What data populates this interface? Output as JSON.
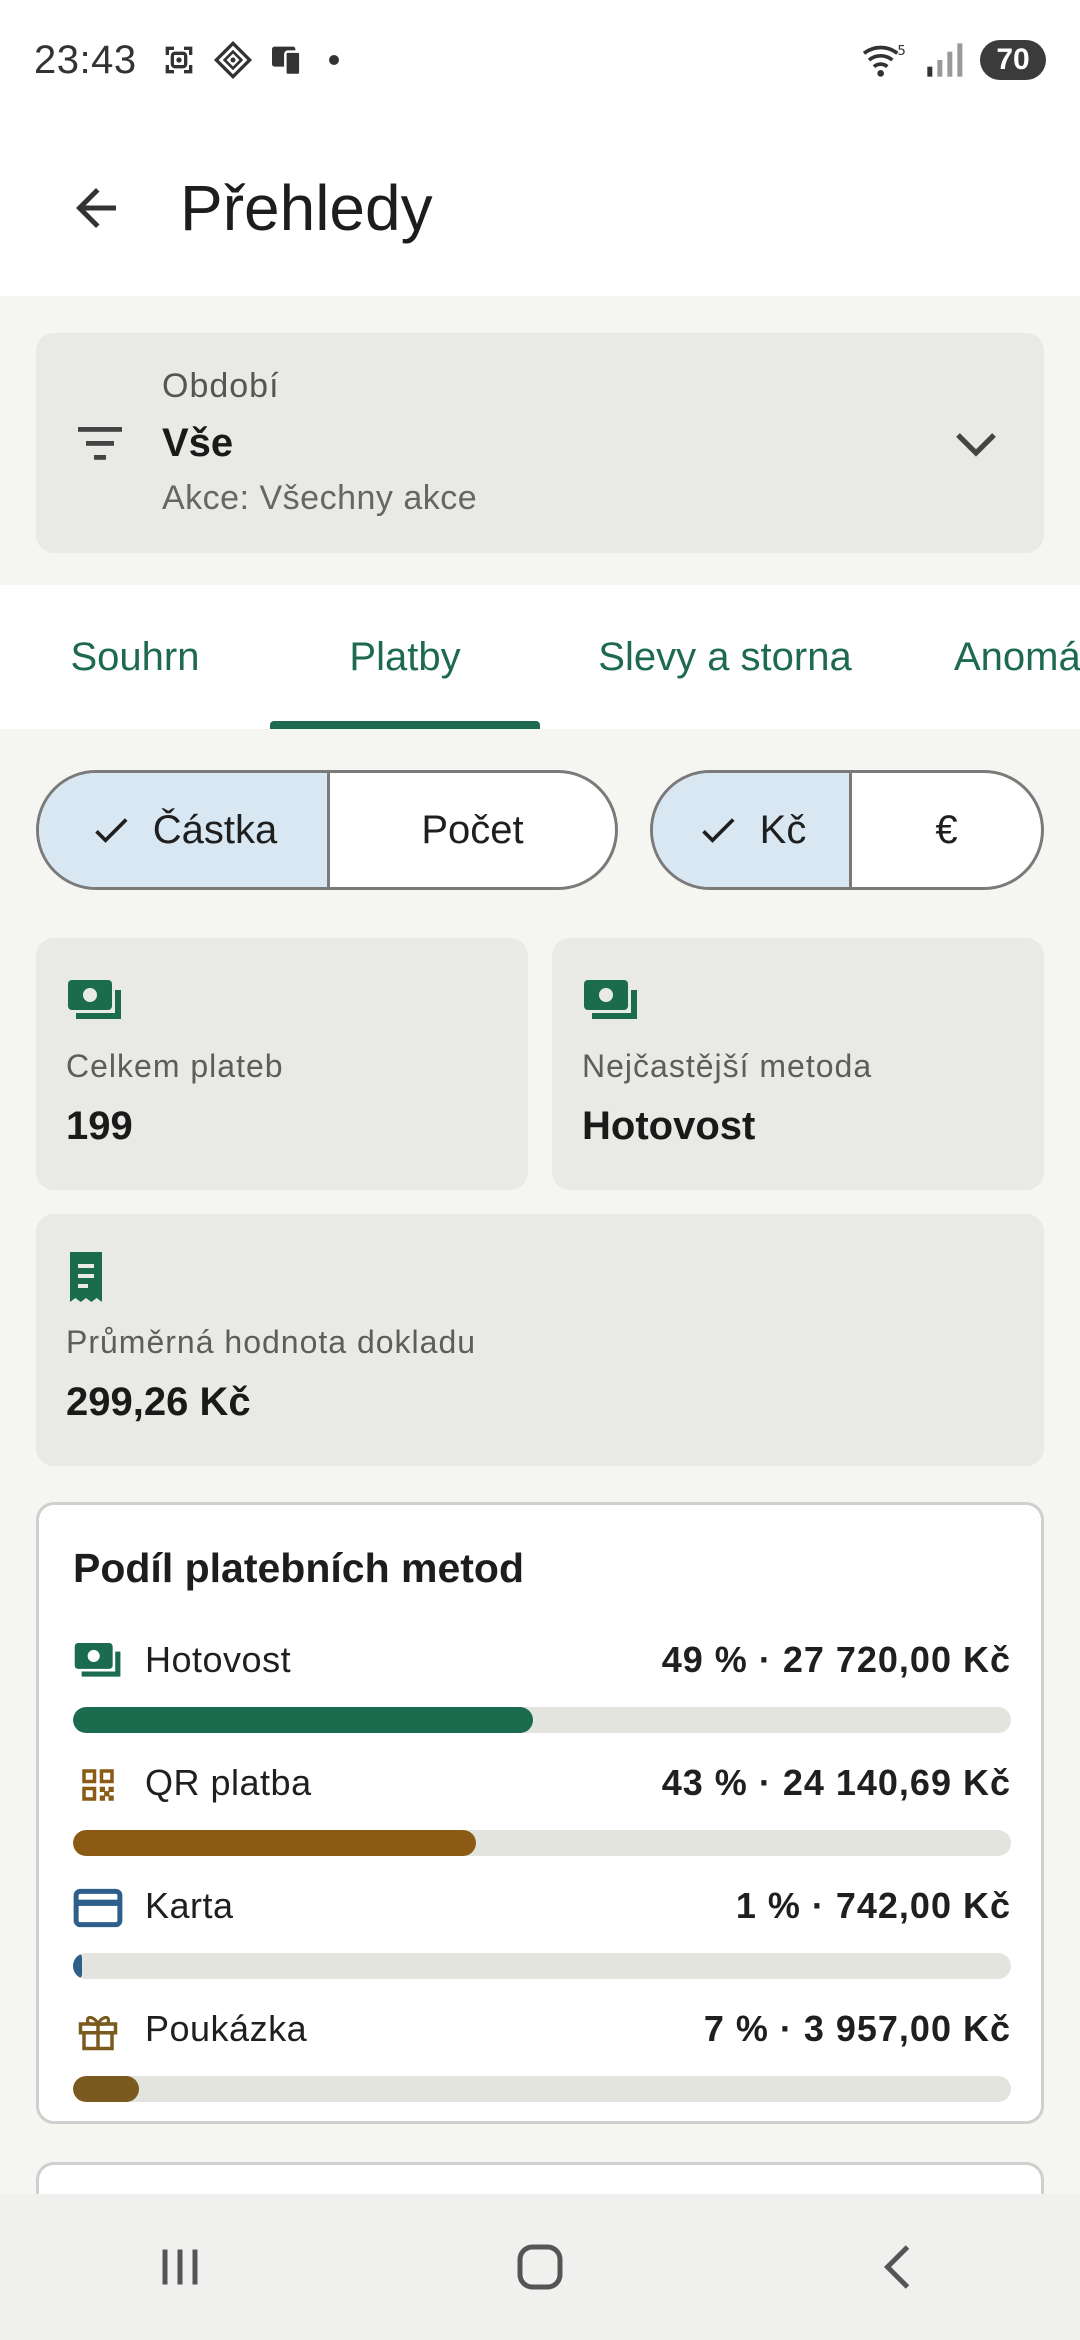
{
  "status_bar": {
    "time": "23:43",
    "battery": "70",
    "icons": [
      "screenshot-icon",
      "smart-view-icon",
      "device-icon",
      "notification-dot",
      "wifi-icon",
      "signal-icon",
      "battery-icon"
    ]
  },
  "app_bar": {
    "title": "Přehledy",
    "back_icon": "arrow-back-icon"
  },
  "filter": {
    "label": "Období",
    "value": "Vše",
    "subtitle": "Akce: Všechny akce",
    "icon": "filter-list-icon",
    "chevron": "chevron-down-icon"
  },
  "tabs": {
    "items": [
      {
        "label": "Souhrn",
        "active": false
      },
      {
        "label": "Platby",
        "active": true
      },
      {
        "label": "Slevy a storna",
        "active": false
      },
      {
        "label": "Anomá",
        "active": false
      }
    ]
  },
  "toggles": {
    "metric": [
      {
        "label": "Částka",
        "selected": true
      },
      {
        "label": "Počet",
        "selected": false
      }
    ],
    "currency": [
      {
        "label": "Kč",
        "selected": true
      },
      {
        "label": "€",
        "selected": false
      }
    ]
  },
  "stats": {
    "total_payments": {
      "label": "Celkem plateb",
      "value": "199",
      "icon": "payments-icon"
    },
    "most_common": {
      "label": "Nejčastější metoda",
      "value": "Hotovost",
      "icon": "payments-icon"
    },
    "avg_receipt": {
      "label": "Průměrná hodnota dokladu",
      "value": "299,26 Kč",
      "icon": "receipt-icon"
    }
  },
  "payment_share": {
    "title": "Podíl platebních metod",
    "rows": [
      {
        "name": "Hotovost",
        "value": "49 % · 27 720,00 Kč",
        "fraction": 0.49,
        "color": "#1b6b4f",
        "icon": "payments-icon"
      },
      {
        "name": "QR platba",
        "value": "43 % · 24 140,69 Kč",
        "fraction": 0.43,
        "color": "#8b5a14",
        "icon": "qr-code-icon"
      },
      {
        "name": "Karta",
        "value": "1 % · 742,00 Kč",
        "fraction": 0.01,
        "color": "#2e5f8a",
        "icon": "credit-card-icon"
      },
      {
        "name": "Poukázka",
        "value": "7 % · 3 957,00 Kč",
        "fraction": 0.07,
        "color": "#7a5a1e",
        "icon": "gift-icon"
      }
    ]
  },
  "colors": {
    "accent": "#1e6a50",
    "selected_segment": "#d8e7f2",
    "card_bg": "#e9e9e5",
    "track": "#e4e4de"
  },
  "nav_bar": {
    "icons": [
      "recent-apps-icon",
      "home-icon",
      "back-icon"
    ]
  }
}
